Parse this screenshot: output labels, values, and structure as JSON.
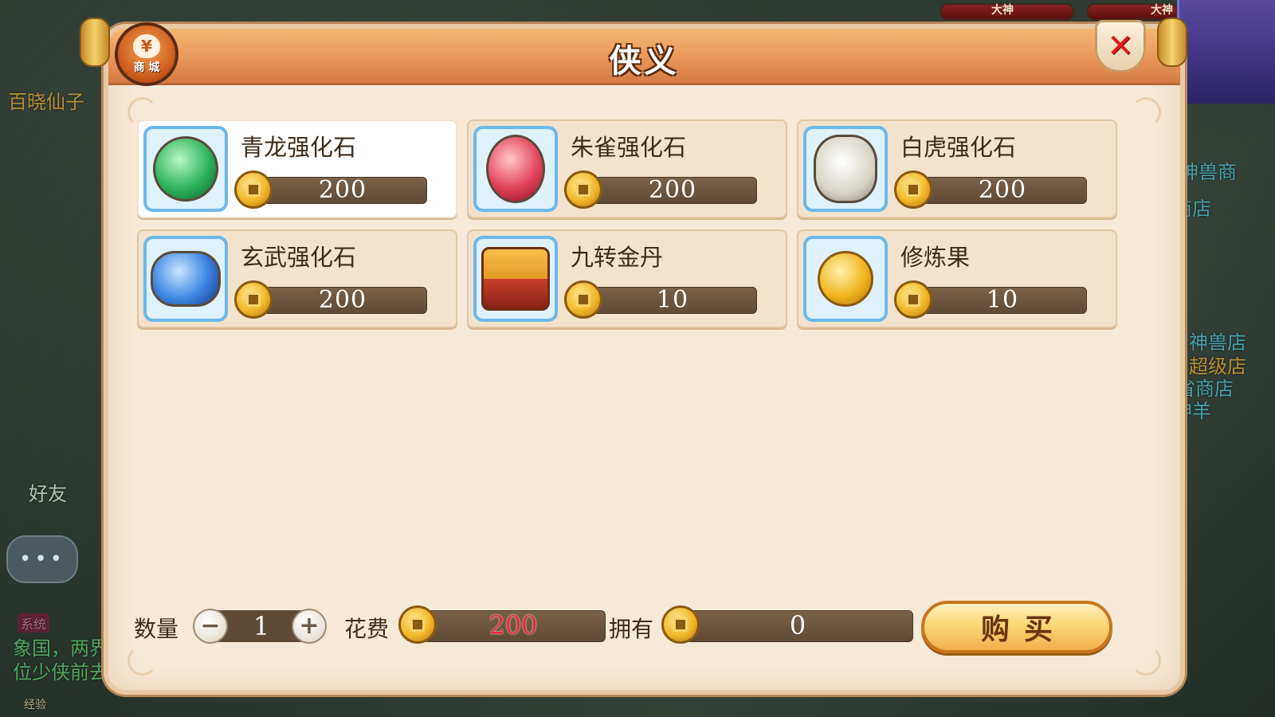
{
  "background": {
    "scene_texts": [
      {
        "text": "百晓仙子"
      },
      {
        "text": "神兽商"
      },
      {
        "text": "商店"
      },
      {
        "text": "神兽店"
      },
      {
        "text": "超级店"
      },
      {
        "text": "省商店"
      },
      {
        "text": "神羊"
      },
      {
        "text": "好友"
      },
      {
        "text": "象国，两界"
      },
      {
        "text": "位少侠前去"
      },
      {
        "text": "经验"
      },
      {
        "text": "系统"
      }
    ],
    "hud": {
      "label_1": "大神",
      "label_2": "大神"
    }
  },
  "shop": {
    "badge_symbol": "¥",
    "badge_label": "商 城",
    "title": "侠义",
    "close_symbol": "✕",
    "items": [
      {
        "name": "青龙强化石",
        "price": "200",
        "icon": "green-dragon-stone-icon",
        "selected": true
      },
      {
        "name": "朱雀强化石",
        "price": "200",
        "icon": "vermilion-bird-stone-icon",
        "selected": false
      },
      {
        "name": "白虎强化石",
        "price": "200",
        "icon": "white-tiger-stone-icon",
        "selected": false
      },
      {
        "name": "玄武强化石",
        "price": "200",
        "icon": "black-tortoise-stone-icon",
        "selected": false
      },
      {
        "name": "九转金丹",
        "price": "10",
        "icon": "golden-pill-chest-icon",
        "selected": false
      },
      {
        "name": "修炼果",
        "price": "10",
        "icon": "cultivation-fruit-icon",
        "selected": false
      }
    ],
    "footer": {
      "quantity_label": "数量",
      "quantity_value": "1",
      "minus_symbol": "−",
      "plus_symbol": "+",
      "cost_label": "花费",
      "cost_value": "200",
      "owned_label": "拥有",
      "owned_value": "0",
      "buy_label": "购买"
    },
    "colors": {
      "title_bar": "#e9965a",
      "cost_text": "#e8283a",
      "icon_frame": "#6cb8ea",
      "buy_button": "#fbd776"
    }
  }
}
